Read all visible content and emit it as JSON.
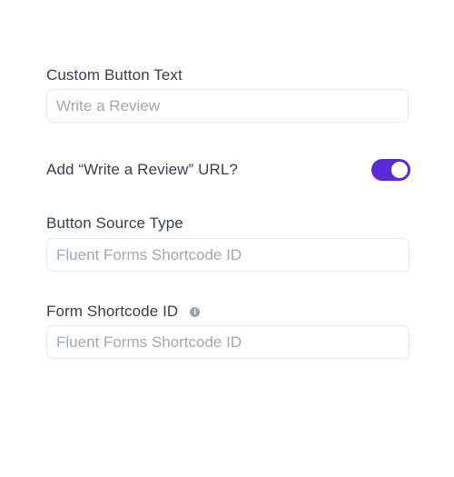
{
  "fields": {
    "custom_button_text": {
      "label": "Custom Button Text",
      "placeholder": "Write a Review"
    },
    "add_url": {
      "label": "Add “Write a Review” URL?",
      "enabled": true
    },
    "button_source_type": {
      "label": "Button Source Type",
      "placeholder": "Fluent Forms Shortcode ID"
    },
    "form_shortcode_id": {
      "label": "Form Shortcode ID",
      "info_icon": "info-icon",
      "placeholder": "Fluent Forms Shortcode ID"
    }
  },
  "colors": {
    "toggle_on": "#5b2ad6",
    "placeholder": "#a2a7b2",
    "label": "#3b3f4b",
    "border": "#e6e8ec"
  }
}
